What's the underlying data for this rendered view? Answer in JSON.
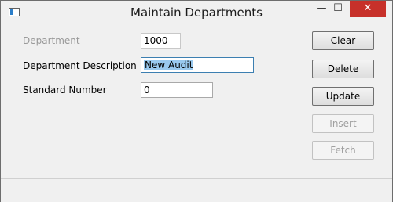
{
  "window": {
    "title": "Maintain Departments",
    "minimize_glyph": "—",
    "maximize_glyph": "☐",
    "close_glyph": "✕"
  },
  "form": {
    "department_label": "Department",
    "department_value": "1000",
    "description_label": "Department Description",
    "description_value": "New Audit",
    "standard_number_label": "Standard Number",
    "standard_number_value": "0"
  },
  "buttons": {
    "clear": "Clear",
    "delete": "Delete",
    "update": "Update",
    "insert": "Insert",
    "fetch": "Fetch"
  },
  "colors": {
    "close_button": "#c7312a",
    "selection": "#99c9ef"
  }
}
